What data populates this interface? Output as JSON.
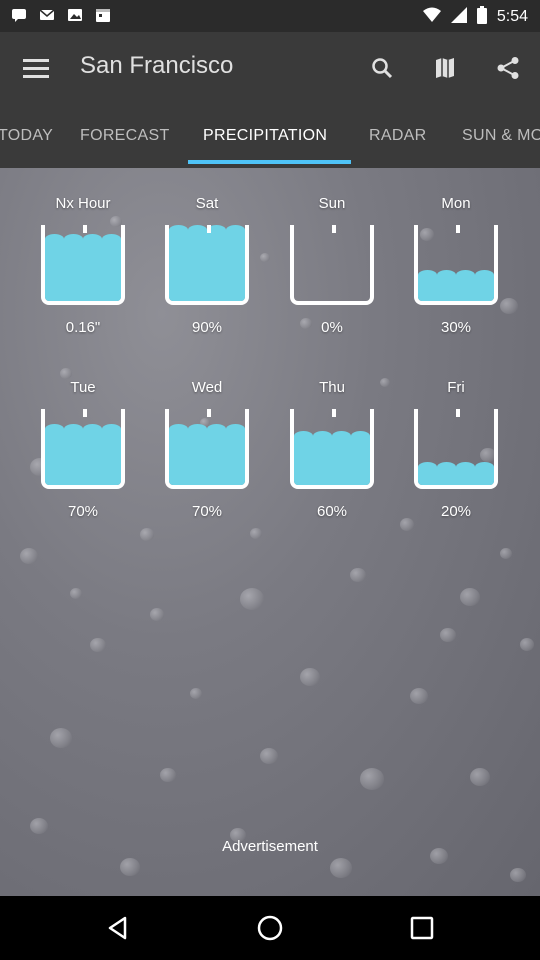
{
  "status_bar": {
    "time": "5:54",
    "left_icons": [
      "message-icon",
      "mail-icon",
      "gallery-icon",
      "calendar-icon"
    ],
    "right_icons": [
      "wifi-icon",
      "signal-icon",
      "battery-icon"
    ]
  },
  "app_bar": {
    "title": "San Francisco",
    "actions": [
      "search-icon",
      "map-icon",
      "share-icon"
    ],
    "background_color": "#3a3a3a"
  },
  "tabs": [
    {
      "label": "TODAY",
      "active": false
    },
    {
      "label": "FORECAST",
      "active": false
    },
    {
      "label": "PRECIPITATION",
      "active": true
    },
    {
      "label": "RADAR",
      "active": false
    },
    {
      "label": "SUN & MOON",
      "active": false
    }
  ],
  "accent_color": "#4fc3f7",
  "water_color": "#6fd3e6",
  "precipitation": [
    {
      "label": "Nx Hour",
      "value": "0.16\"",
      "level": 0.78
    },
    {
      "label": "Sat",
      "value": "90%",
      "level": 0.9
    },
    {
      "label": "Sun",
      "value": "0%",
      "level": 0.0
    },
    {
      "label": "Mon",
      "value": "30%",
      "level": 0.3
    },
    {
      "label": "Tue",
      "value": "70%",
      "level": 0.7
    },
    {
      "label": "Wed",
      "value": "70%",
      "level": 0.7
    },
    {
      "label": "Thu",
      "value": "60%",
      "level": 0.6
    },
    {
      "label": "Fri",
      "value": "20%",
      "level": 0.2
    }
  ],
  "advertisement_label": "Advertisement",
  "nav_bar": [
    "back-icon",
    "home-icon",
    "recents-icon"
  ]
}
